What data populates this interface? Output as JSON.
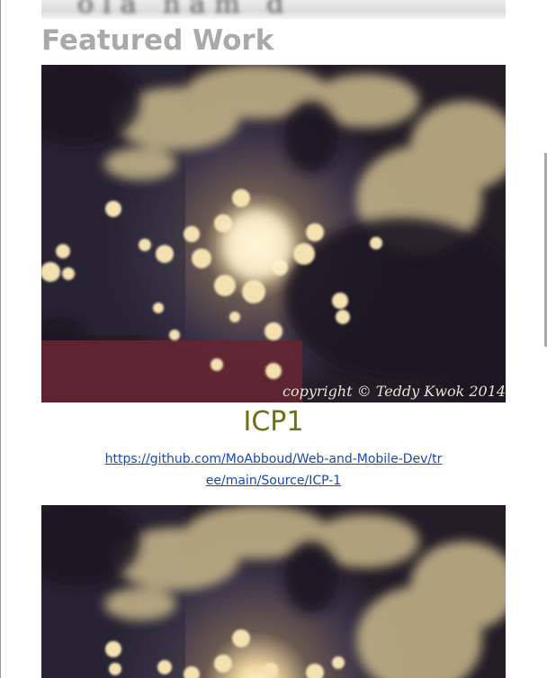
{
  "section": {
    "title": "Featured Work"
  },
  "projects": [
    {
      "title": "ICP1",
      "link_text": "https://github.com/MoAbboud/Web-and-Mobile-Dev/tree/main/Source/ICP-1",
      "image": {
        "watermark": "copyright © Teddy Kwok 2014"
      }
    }
  ],
  "colors": {
    "section_title": "#a9a9a9",
    "project_title": "#6b7113",
    "link": "#1a4ba8"
  }
}
